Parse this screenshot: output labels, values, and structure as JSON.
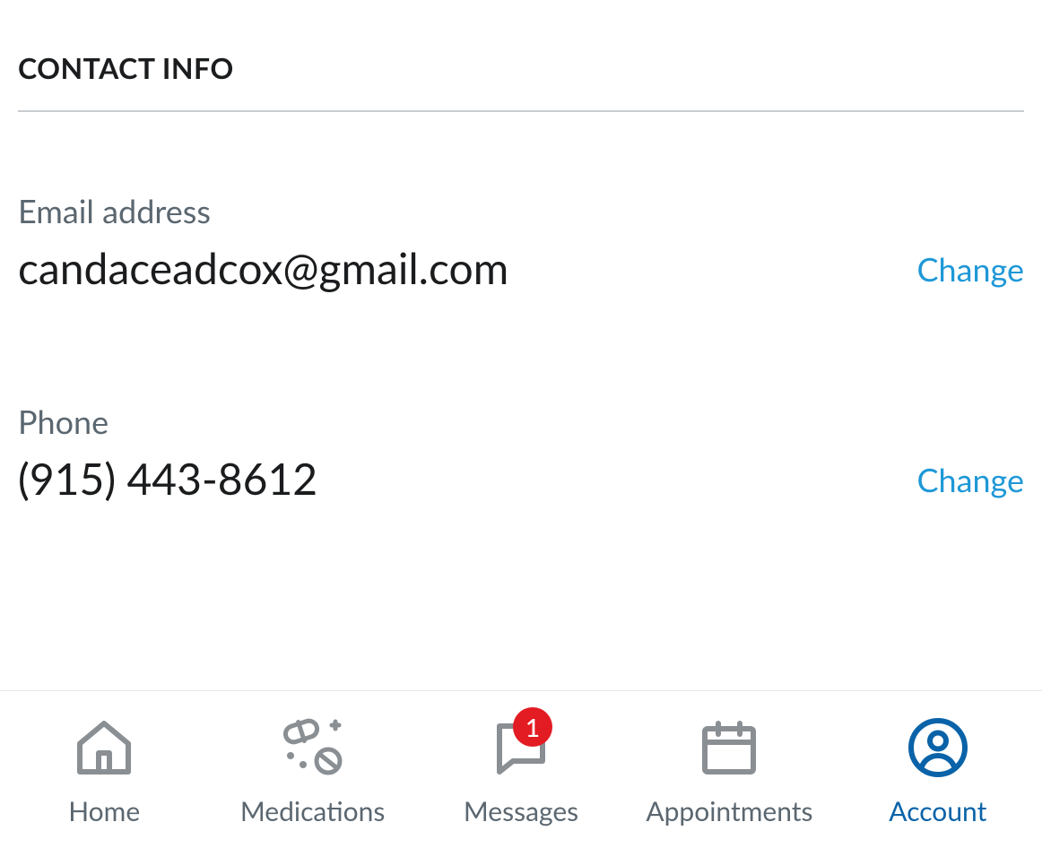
{
  "section": {
    "title": "CONTACT INFO"
  },
  "fields": {
    "email": {
      "label": "Email address",
      "value": "candaceadcox@gmail.com",
      "action": "Change"
    },
    "phone": {
      "label": "Phone",
      "value": "(915) 443-8612",
      "action": "Change"
    }
  },
  "nav": {
    "home": {
      "label": "Home"
    },
    "medications": {
      "label": "Medications"
    },
    "messages": {
      "label": "Messages",
      "badge": "1"
    },
    "appointments": {
      "label": "Appointments"
    },
    "account": {
      "label": "Account"
    }
  },
  "colors": {
    "accent": "#1e98d7",
    "activeNav": "#0a63a8",
    "badge": "#e31b23",
    "labelMuted": "#5b6770",
    "iconGray": "#8a8f94"
  }
}
